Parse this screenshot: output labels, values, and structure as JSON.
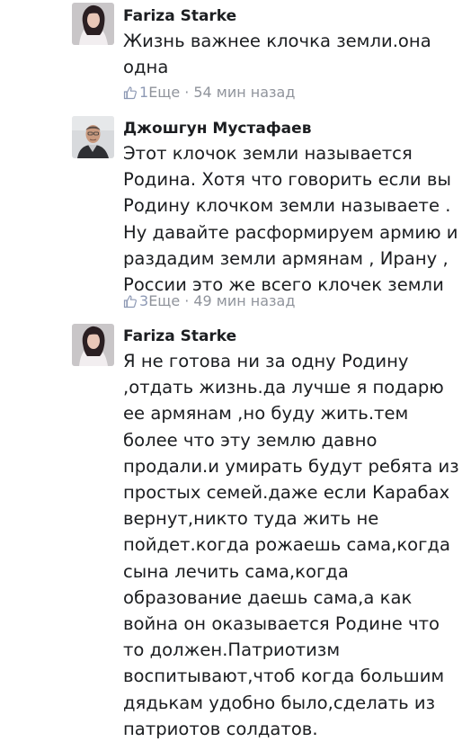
{
  "comments": [
    {
      "author": "Fariza Starke",
      "lines": [
        "Жизнь важнее клочка земли.она",
        "одна"
      ],
      "likes": "1",
      "more_label": "Еще",
      "separator": "·",
      "time": "54 мин назад"
    },
    {
      "author": "Джошгун Мустафаев",
      "lines": [
        "Этот клочок земли называется",
        "Родина. Хотя что говорить если вы",
        "Родину клочком земли называете .",
        "Ну давайте расформируем армию и",
        "раздадим земли армянам , Ирану ,",
        "России это же всего клочек земли"
      ],
      "likes": "3",
      "more_label": "Еще",
      "separator": "·",
      "time": "49 мин назад"
    },
    {
      "author": "Fariza Starke",
      "lines": [
        "Я не готова ни за одну Родину",
        ",отдать жизнь.да лучше я подарю",
        "ее армянам ,но буду жить.тем",
        "более что эту землю давно",
        "продали.и умирать будут ребята из",
        "простых семей.даже если Карабах",
        "вернут,никто туда жить не",
        "пойдет.когда рожаешь сама,когда",
        "сына лечить сама,когда",
        "образование даешь сама,а как",
        "война он оказывается Родине что",
        "то должен.Патриотизм",
        "воспитывают,чтоб когда большим",
        "дядькам удобно было,сделать из",
        "патриотов солдатов."
      ]
    }
  ],
  "icons": {
    "like": "thumbs-up-icon"
  },
  "colors": {
    "text": "#1c1e21",
    "meta": "#90949c",
    "like": "#8d99b4"
  }
}
